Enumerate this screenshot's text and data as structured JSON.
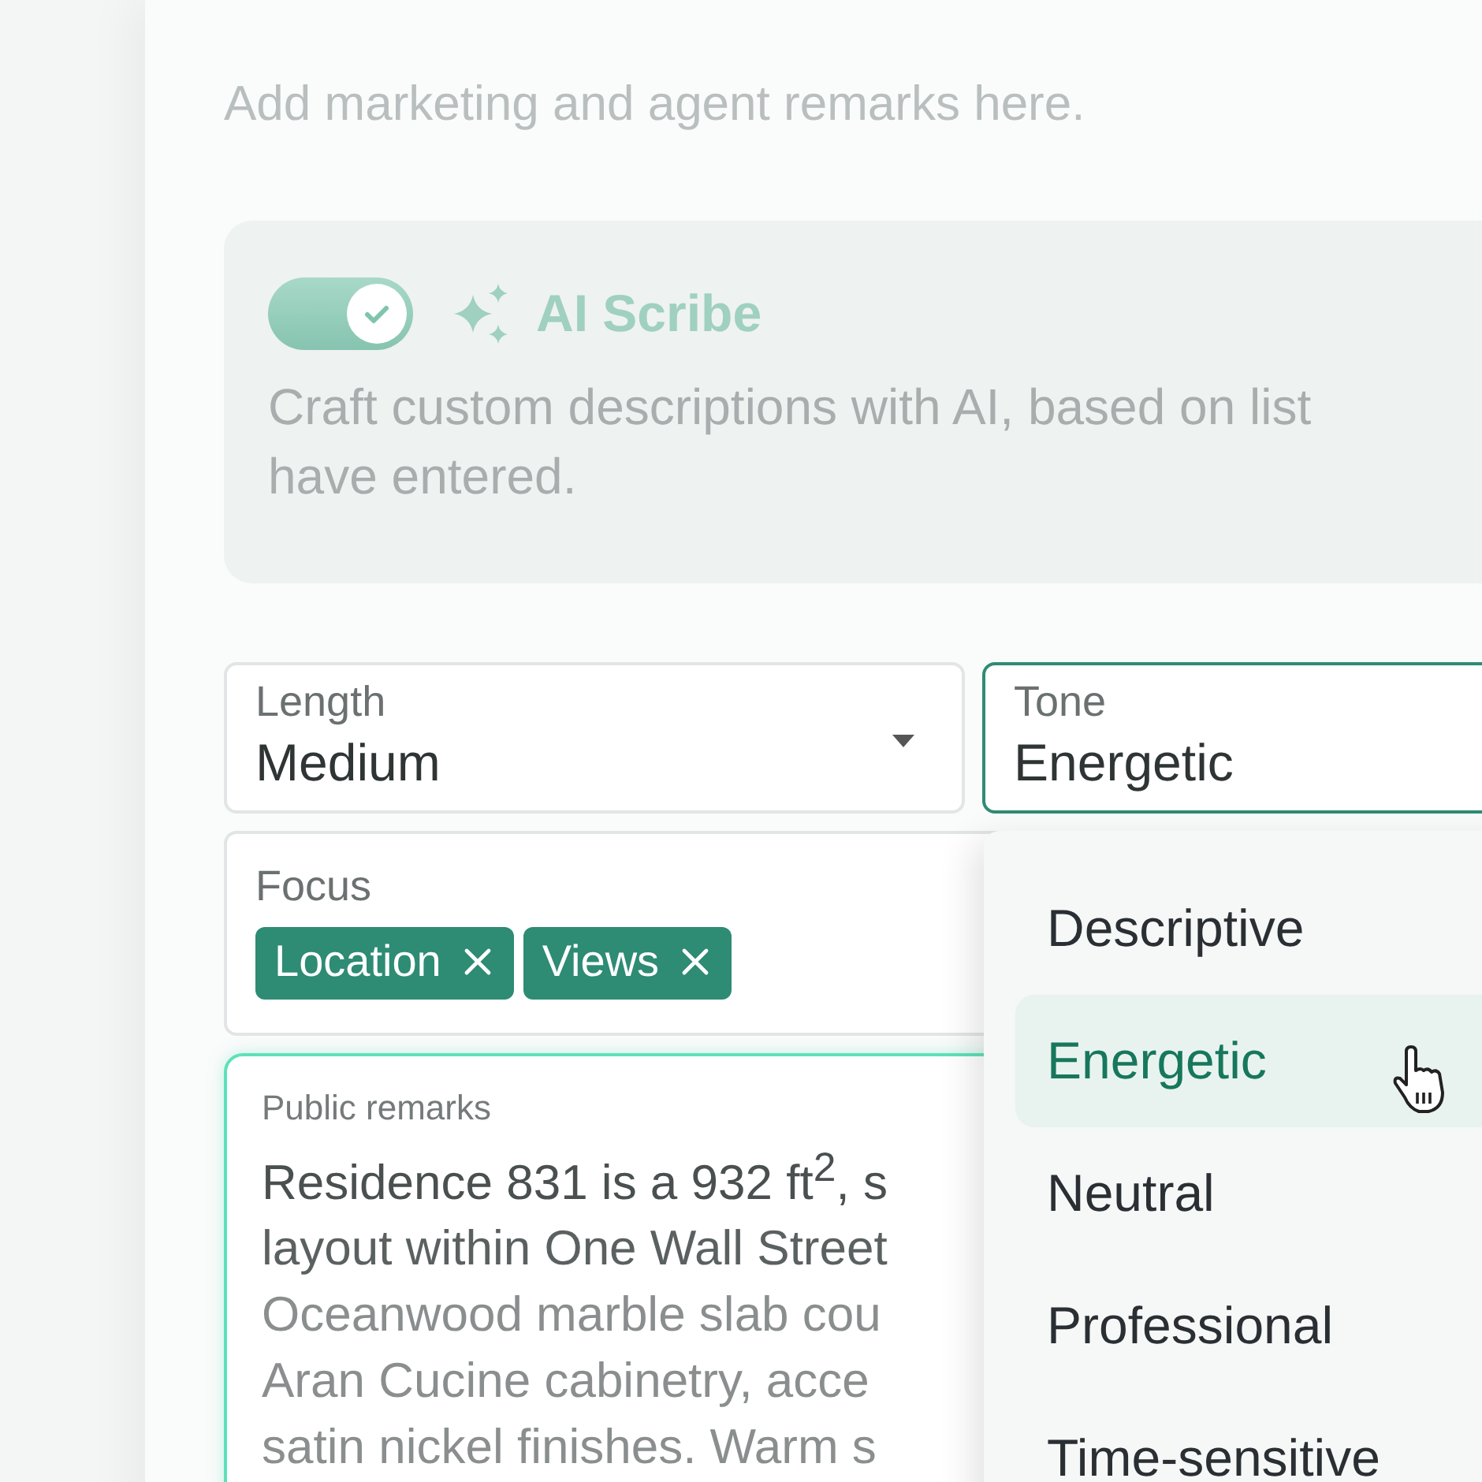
{
  "placeholder_text": "Add marketing and agent remarks here.",
  "ai_scribe": {
    "enabled": true,
    "title": "AI Scribe",
    "description_lines": [
      "Craft custom descriptions with AI, based on list",
      "have entered."
    ]
  },
  "length": {
    "label": "Length",
    "value": "Medium"
  },
  "tone": {
    "label": "Tone",
    "value": "Energetic",
    "focused": true
  },
  "focus": {
    "label": "Focus",
    "chips": [
      {
        "label": "Location"
      },
      {
        "label": "Views"
      }
    ]
  },
  "remarks": {
    "label": "Public remarks",
    "lines": [
      "Residence 831 is a 932 ft$^{2}$, s",
      "layout within One Wall Street",
      "Oceanwood marble slab cou",
      "Aran Cucine cabinetry, acce",
      "satin nickel finishes. Warm s"
    ]
  },
  "tone_menu": {
    "options": [
      {
        "label": "Descriptive",
        "selected": false
      },
      {
        "label": "Energetic",
        "selected": true
      },
      {
        "label": "Neutral",
        "selected": false
      },
      {
        "label": "Professional",
        "selected": false
      },
      {
        "label": "Time-sensitive",
        "selected": false
      }
    ]
  }
}
